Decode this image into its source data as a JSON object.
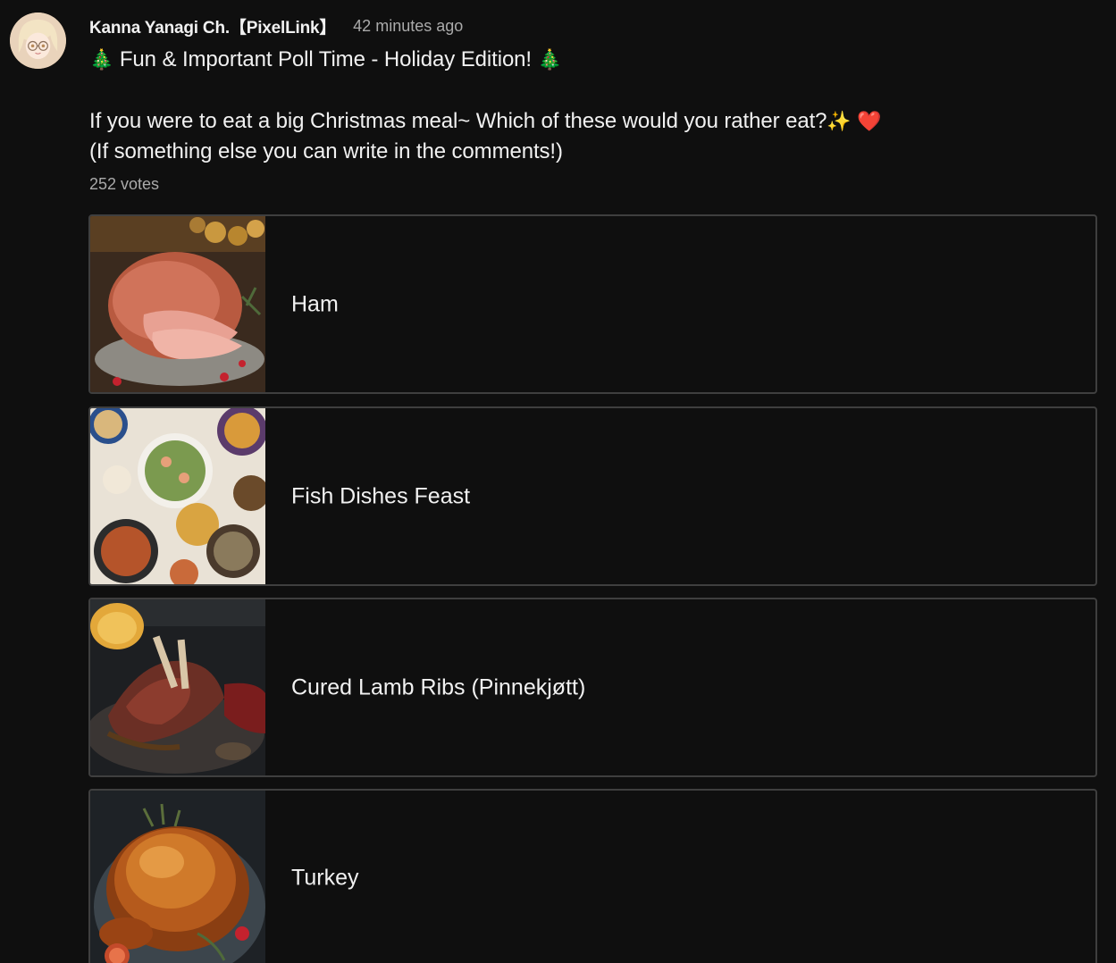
{
  "post": {
    "author": "Kanna Yanagi Ch.【PixelLink】",
    "time": "42 minutes ago",
    "title_text": "Fun & Important Poll Time - Holiday Edition!",
    "title_emoji": "🎄",
    "question": "If you were to eat a big Christmas meal~ Which of these would you rather eat?",
    "question_emoji_sparkle": "✨",
    "question_emoji_heart": "❤️",
    "subtext": "(If something else you can write in the comments!)",
    "votes": "252 votes"
  },
  "poll": {
    "options": [
      {
        "label": "Ham",
        "image": "ham-photo"
      },
      {
        "label": "Fish Dishes Feast",
        "image": "fish-feast-photo"
      },
      {
        "label": "Cured Lamb Ribs (Pinnekjøtt)",
        "image": "lamb-ribs-photo"
      },
      {
        "label": "Turkey",
        "image": "turkey-photo"
      }
    ]
  },
  "colors": {
    "background": "#0f0f0f",
    "text_primary": "#f1f1f1",
    "text_secondary": "#aaaaaa",
    "option_border": "#3f3f3f"
  }
}
